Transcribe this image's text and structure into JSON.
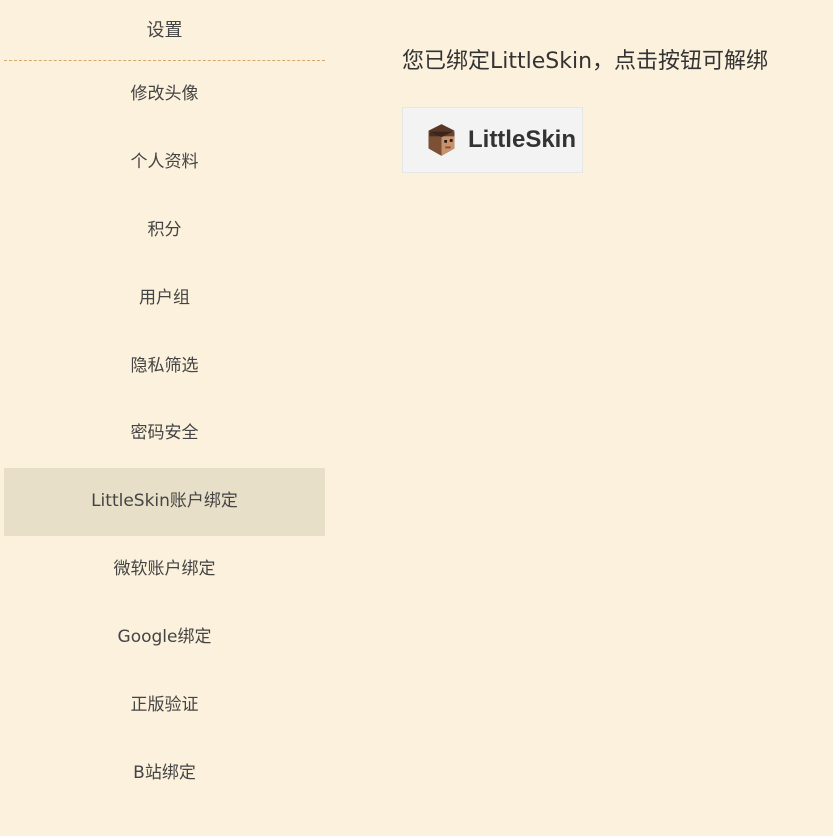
{
  "sidebar": {
    "title": "设置",
    "items": [
      {
        "label": "修改头像"
      },
      {
        "label": "个人资料"
      },
      {
        "label": "积分"
      },
      {
        "label": "用户组"
      },
      {
        "label": "隐私筛选"
      },
      {
        "label": "密码安全"
      },
      {
        "label": "LittleSkin账户绑定",
        "active": true
      },
      {
        "label": "微软账户绑定"
      },
      {
        "label": "Google绑定"
      },
      {
        "label": "正版验证"
      },
      {
        "label": "B站绑定"
      }
    ]
  },
  "content": {
    "message": "您已绑定LittleSkin，点击按钮可解绑",
    "button_label": "LittleSkin",
    "logo_icon": "littleskin-head-icon"
  },
  "colors": {
    "background": "#fbf1dc",
    "active_item": "#e8dfc8",
    "divider": "#d7a86c"
  }
}
